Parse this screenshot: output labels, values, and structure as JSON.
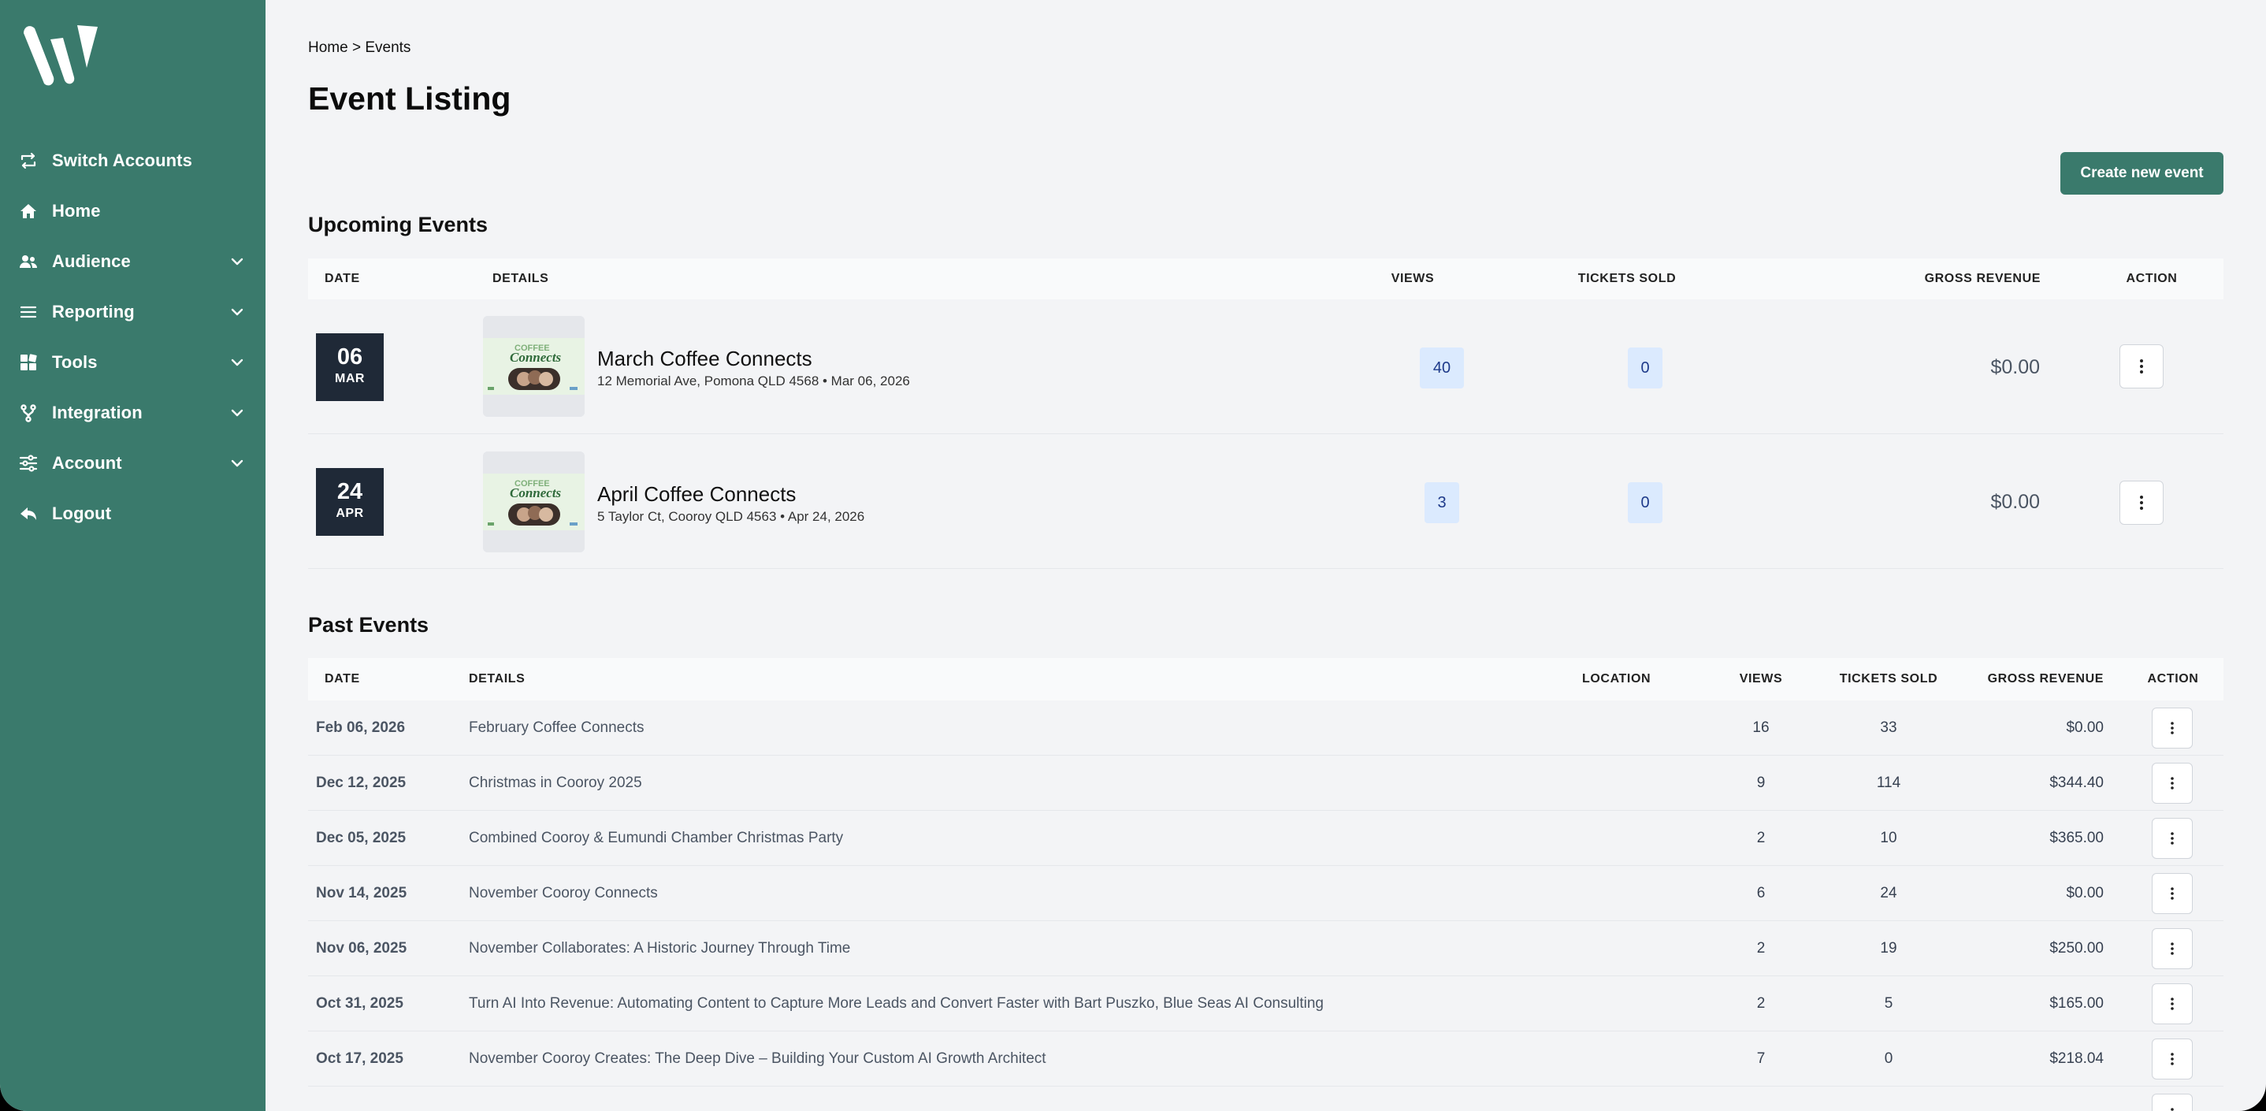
{
  "sidebar": {
    "items": [
      {
        "label": "Switch Accounts",
        "icon": "switch-icon",
        "expandable": false
      },
      {
        "label": "Home",
        "icon": "home-icon",
        "expandable": false
      },
      {
        "label": "Audience",
        "icon": "users-icon",
        "expandable": true
      },
      {
        "label": "Reporting",
        "icon": "list-icon",
        "expandable": true
      },
      {
        "label": "Tools",
        "icon": "grid-icon",
        "expandable": true
      },
      {
        "label": "Integration",
        "icon": "branch-icon",
        "expandable": true
      },
      {
        "label": "Account",
        "icon": "sliders-icon",
        "expandable": true
      },
      {
        "label": "Logout",
        "icon": "logout-icon",
        "expandable": false
      }
    ]
  },
  "breadcrumb": "Home > Events",
  "page_title": "Event Listing",
  "create_button": "Create new event",
  "upcoming": {
    "title": "Upcoming Events",
    "headers": {
      "date": "DATE",
      "details": "DETAILS",
      "views": "VIEWS",
      "tickets": "TICKETS SOLD",
      "revenue": "GROSS REVENUE",
      "action": "ACTION"
    },
    "rows": [
      {
        "day": "06",
        "month": "MAR",
        "name": "March Coffee Connects",
        "sub": "12 Memorial Ave, Pomona QLD 4568 • Mar 06, 2026",
        "views": "40",
        "tickets": "0",
        "revenue": "$0.00"
      },
      {
        "day": "24",
        "month": "APR",
        "name": "April Coffee Connects",
        "sub": "5 Taylor Ct, Cooroy QLD 4563 • Apr 24, 2026",
        "views": "3",
        "tickets": "0",
        "revenue": "$0.00"
      }
    ]
  },
  "past": {
    "title": "Past Events",
    "headers": {
      "date": "DATE",
      "details": "DETAILS",
      "location": "LOCATION",
      "views": "VIEWS",
      "tickets": "TICKETS SOLD",
      "revenue": "GROSS REVENUE",
      "action": "ACTION"
    },
    "rows": [
      {
        "date": "Feb 06, 2026",
        "name": "February Coffee Connects",
        "views": "16",
        "tickets": "33",
        "revenue": "$0.00"
      },
      {
        "date": "Dec 12, 2025",
        "name": "Christmas in Cooroy 2025",
        "views": "9",
        "tickets": "114",
        "revenue": "$344.40"
      },
      {
        "date": "Dec 05, 2025",
        "name": "Combined Cooroy & Eumundi Chamber Christmas Party",
        "views": "2",
        "tickets": "10",
        "revenue": "$365.00"
      },
      {
        "date": "Nov 14, 2025",
        "name": "November Cooroy Connects",
        "views": "6",
        "tickets": "24",
        "revenue": "$0.00"
      },
      {
        "date": "Nov 06, 2025",
        "name": "November Collaborates: A Historic Journey Through Time",
        "views": "2",
        "tickets": "19",
        "revenue": "$250.00"
      },
      {
        "date": "Oct 31, 2025",
        "name": "Turn AI Into Revenue: Automating Content to Capture More Leads and Convert Faster with Bart Puszko, Blue Seas AI Consulting",
        "views": "2",
        "tickets": "5",
        "revenue": "$165.00"
      },
      {
        "date": "Oct 17, 2025",
        "name": "November Cooroy Creates: The Deep Dive – Building Your Custom AI Growth Architect",
        "views": "7",
        "tickets": "0",
        "revenue": "$218.04"
      }
    ]
  },
  "thumbnail_text": {
    "line1": "COFFEE",
    "line2": "Connects"
  },
  "colors": {
    "brand": "#3a7a6c",
    "date_box": "#1f2937",
    "pill_bg": "#dbeafe",
    "pill_text": "#1e3a8a"
  }
}
